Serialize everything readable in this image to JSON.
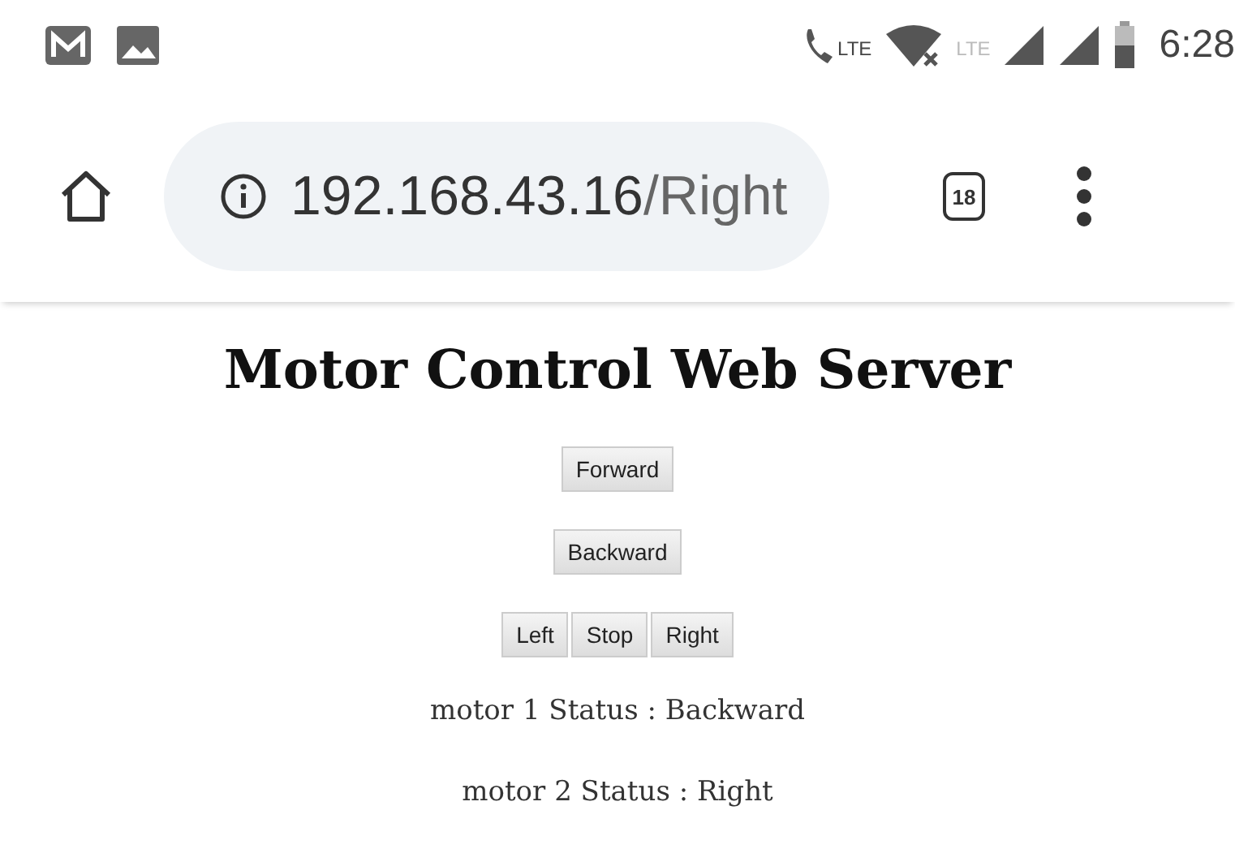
{
  "status_bar": {
    "call_badge": "LTE",
    "network": "LTE",
    "time": "6:28"
  },
  "address_bar": {
    "host": "192.168.43.16",
    "path": "/Right",
    "tab_count": "18"
  },
  "page": {
    "title": "Motor Control Web Server",
    "button_rows": [
      [
        "Forward"
      ],
      [
        "Backward"
      ],
      [
        "Left",
        "Stop",
        "Right"
      ]
    ],
    "status_lines": [
      "motor 1 Status : Backward",
      "motor 2 Status : Right"
    ]
  }
}
